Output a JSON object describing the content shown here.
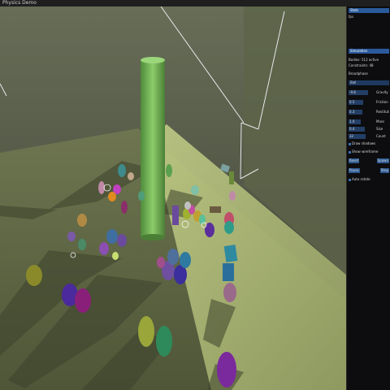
{
  "window": {
    "title": "Physics Demo"
  },
  "panel": {
    "header1": "Stats",
    "stat_line": "fps",
    "header2": "Simulation",
    "info_line1": "Bodies: 512 active",
    "info_line2": "Constraints: 48",
    "info_line3": "Broadphase",
    "dropdown_value": "Ball",
    "slider_rows": [
      {
        "label": "Gravity",
        "value": "-9.8",
        "fill": 0.8
      },
      {
        "label": "Friction",
        "value": "0.5",
        "fill": 0.6
      },
      {
        "label": "Restitution",
        "value": "0.3",
        "fill": 0.55
      },
      {
        "label": "Mass",
        "value": "1.0",
        "fill": 0.5
      },
      {
        "label": "Size",
        "value": "0.4",
        "fill": 0.65
      },
      {
        "label": "Count",
        "value": "32",
        "fill": 0.7
      }
    ],
    "checkboxes": [
      {
        "label": "Draw shadows",
        "checked": true
      },
      {
        "label": "Show wireframe",
        "checked": true
      }
    ],
    "buttons": [
      {
        "label": "Reset",
        "right": "Spawn"
      },
      {
        "label": "Pause",
        "right": "Step"
      }
    ],
    "last_check": "Auto rotate"
  },
  "colors": {
    "floor": "#9aa56a",
    "wall": "#6f7658",
    "pillar": "#7fbf5c",
    "panel_bg": "#0d0d0f",
    "accent": "#2a5a9b"
  }
}
